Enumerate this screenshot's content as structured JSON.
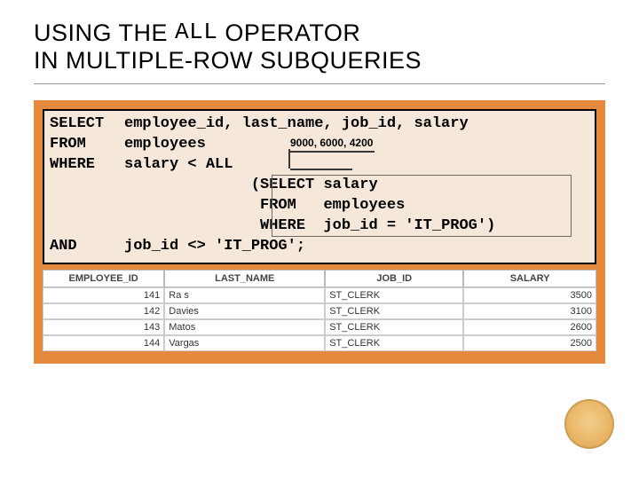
{
  "title": {
    "part1": "USING THE",
    "op": "ALL",
    "part2": "OPERATOR",
    "line2": "IN MULTIPLE-ROW SUBQUERIES"
  },
  "sql": {
    "kw_select": "SELECT",
    "select_cols": "employee_id, last_name, job_id, salary",
    "kw_from": "FROM",
    "from_tbl": "employees",
    "kw_where": "WHERE",
    "where_expr": "salary < ALL",
    "sub_line1_a": "(SELECT",
    "sub_line1_b": "salary",
    "sub_line2_a": " FROM",
    "sub_line2_b": "employees",
    "sub_line3_a": " WHERE",
    "sub_line3_b": "job_id = 'IT_PROG')",
    "kw_and": "AND",
    "and_expr": "job_id <> 'IT_PROG';"
  },
  "annotation": "9000, 6000, 4200",
  "table": {
    "headers": {
      "emp": "EMPLOYEE_ID",
      "name": "LAST_NAME",
      "job": "JOB_ID",
      "sal": "SALARY"
    },
    "rows": [
      {
        "emp": "141",
        "name": "Ra s",
        "job": "ST_CLERK",
        "sal": "3500"
      },
      {
        "emp": "142",
        "name": "Davies",
        "job": "ST_CLERK",
        "sal": "3100"
      },
      {
        "emp": "143",
        "name": "Matos",
        "job": "ST_CLERK",
        "sal": "2600"
      },
      {
        "emp": "144",
        "name": "Vargas",
        "job": "ST_CLERK",
        "sal": "2500"
      }
    ]
  }
}
